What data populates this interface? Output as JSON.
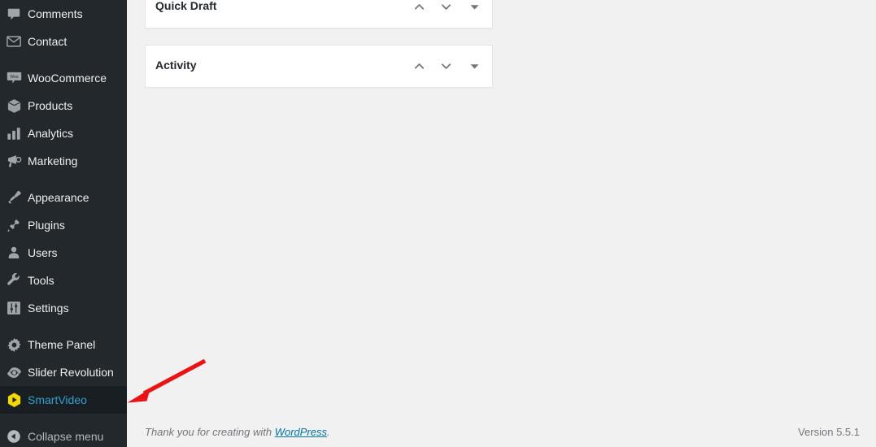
{
  "sidebar": {
    "items": [
      {
        "label": "Comments",
        "icon": "comments-icon",
        "state": "normal",
        "group_start": false
      },
      {
        "label": "Contact",
        "icon": "envelope-icon",
        "state": "normal",
        "group_start": false
      },
      {
        "label": "WooCommerce",
        "icon": "woocommerce-icon",
        "state": "normal",
        "group_start": true
      },
      {
        "label": "Products",
        "icon": "products-box-icon",
        "state": "normal",
        "group_start": false
      },
      {
        "label": "Analytics",
        "icon": "analytics-chart-icon",
        "state": "normal",
        "group_start": false
      },
      {
        "label": "Marketing",
        "icon": "marketing-megaphone-icon",
        "state": "normal",
        "group_start": false
      },
      {
        "label": "Appearance",
        "icon": "appearance-brush-icon",
        "state": "normal",
        "group_start": true
      },
      {
        "label": "Plugins",
        "icon": "plugins-plug-icon",
        "state": "normal",
        "group_start": false
      },
      {
        "label": "Users",
        "icon": "users-icon",
        "state": "normal",
        "group_start": false
      },
      {
        "label": "Tools",
        "icon": "tools-wrench-icon",
        "state": "normal",
        "group_start": false
      },
      {
        "label": "Settings",
        "icon": "settings-sliders-icon",
        "state": "normal",
        "group_start": false
      },
      {
        "label": "Theme Panel",
        "icon": "gear-icon",
        "state": "normal",
        "group_start": true
      },
      {
        "label": "Slider Revolution",
        "icon": "slider-revolution-icon",
        "state": "normal",
        "group_start": false
      },
      {
        "label": "SmartVideo",
        "icon": "smartvideo-hexagon-play-icon",
        "state": "current",
        "group_start": false
      }
    ],
    "collapse": {
      "label": "Collapse menu",
      "icon": "collapse-arrow-icon"
    }
  },
  "main": {
    "widgets": [
      {
        "title": "Quick Draft",
        "order_higher_icon": "chevron-up-icon",
        "order_lower_icon": "chevron-down-icon",
        "toggle_icon": "triangle-down-icon"
      },
      {
        "title": "Activity",
        "order_higher_icon": "chevron-up-icon",
        "order_lower_icon": "chevron-down-icon",
        "toggle_icon": "triangle-down-icon"
      }
    ]
  },
  "footer": {
    "thanks_prefix": "Thank you for creating with ",
    "wordpress_link": "WordPress",
    "thanks_suffix": ".",
    "version": "Version 5.5.1"
  },
  "annotation": {
    "type": "arrow",
    "color": "#ee1111",
    "points_to": "SmartVideo"
  },
  "colors": {
    "sidebar_bg": "#23282d",
    "sidebar_current_bg": "#191e23",
    "current_text": "#2ea2cc",
    "content_bg": "#f1f1f1",
    "link": "#0073aa",
    "smartvideo_icon": "#f5d800",
    "annotation": "#ee1111"
  }
}
